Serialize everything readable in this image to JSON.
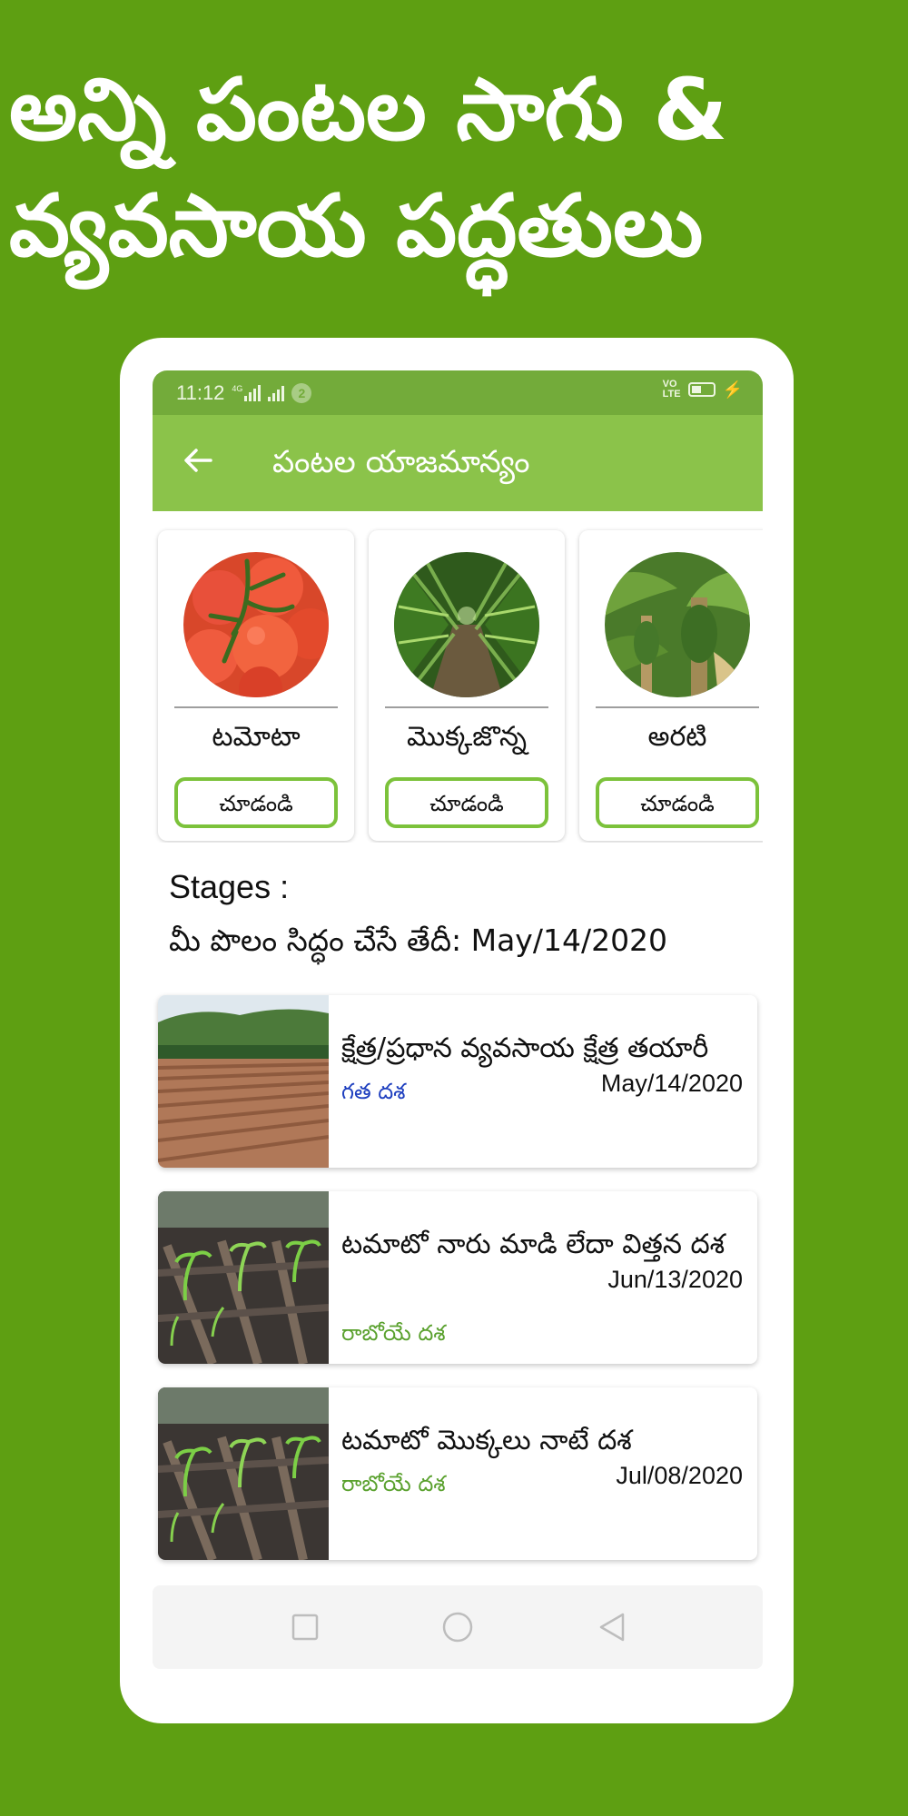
{
  "promo": {
    "line1": "అన్ని పంటల సాగు &",
    "line2": "వ్యవసాయ పద్ధతులు"
  },
  "status_bar": {
    "time": "11:12",
    "network": "4G",
    "notification_count": "2"
  },
  "app_bar": {
    "title": "పంటల యాజమాన్యం"
  },
  "crops": [
    {
      "name": "టమోటా",
      "button_label": "చూడండి",
      "icon": "tomato-image"
    },
    {
      "name": "మొక్కజొన్న",
      "button_label": "చూడండి",
      "icon": "maize-image"
    },
    {
      "name": "అరటి",
      "button_label": "చూడండి",
      "icon": "banana-image"
    }
  ],
  "stages_label": "Stages :",
  "field_ready_date": "మీ పొలం సిద్ధం చేసే తేదీ: May/14/2020",
  "stages": [
    {
      "title": "క్షేత్ర/ప్రధాన వ్యవసాయ క్షేత్ర తయారీ",
      "date": "May/14/2020",
      "status": "గత దశ",
      "status_type": "past",
      "icon": "ploughed-field-image"
    },
    {
      "title": "టమాటో నారు మాడి లేదా విత్తన దశ",
      "date": "Jun/13/2020",
      "status": "రాబోయే దశ",
      "status_type": "upcoming",
      "icon": "seedlings-image"
    },
    {
      "title": "టమాటో మొక్కలు నాటే దశ",
      "date": "Jul/08/2020",
      "status": "రాబోయే దశ",
      "status_type": "upcoming",
      "icon": "seedlings-image"
    }
  ],
  "colors": {
    "background": "#5e9f12",
    "app_bar": "#8bc34a",
    "status_bar": "#73ab3a",
    "button_border": "#7cc23b",
    "past_status": "#1e3fbf",
    "upcoming_status": "#5aa12e"
  },
  "nav_icons": [
    "recents-square-icon",
    "home-circle-icon",
    "back-triangle-icon"
  ]
}
